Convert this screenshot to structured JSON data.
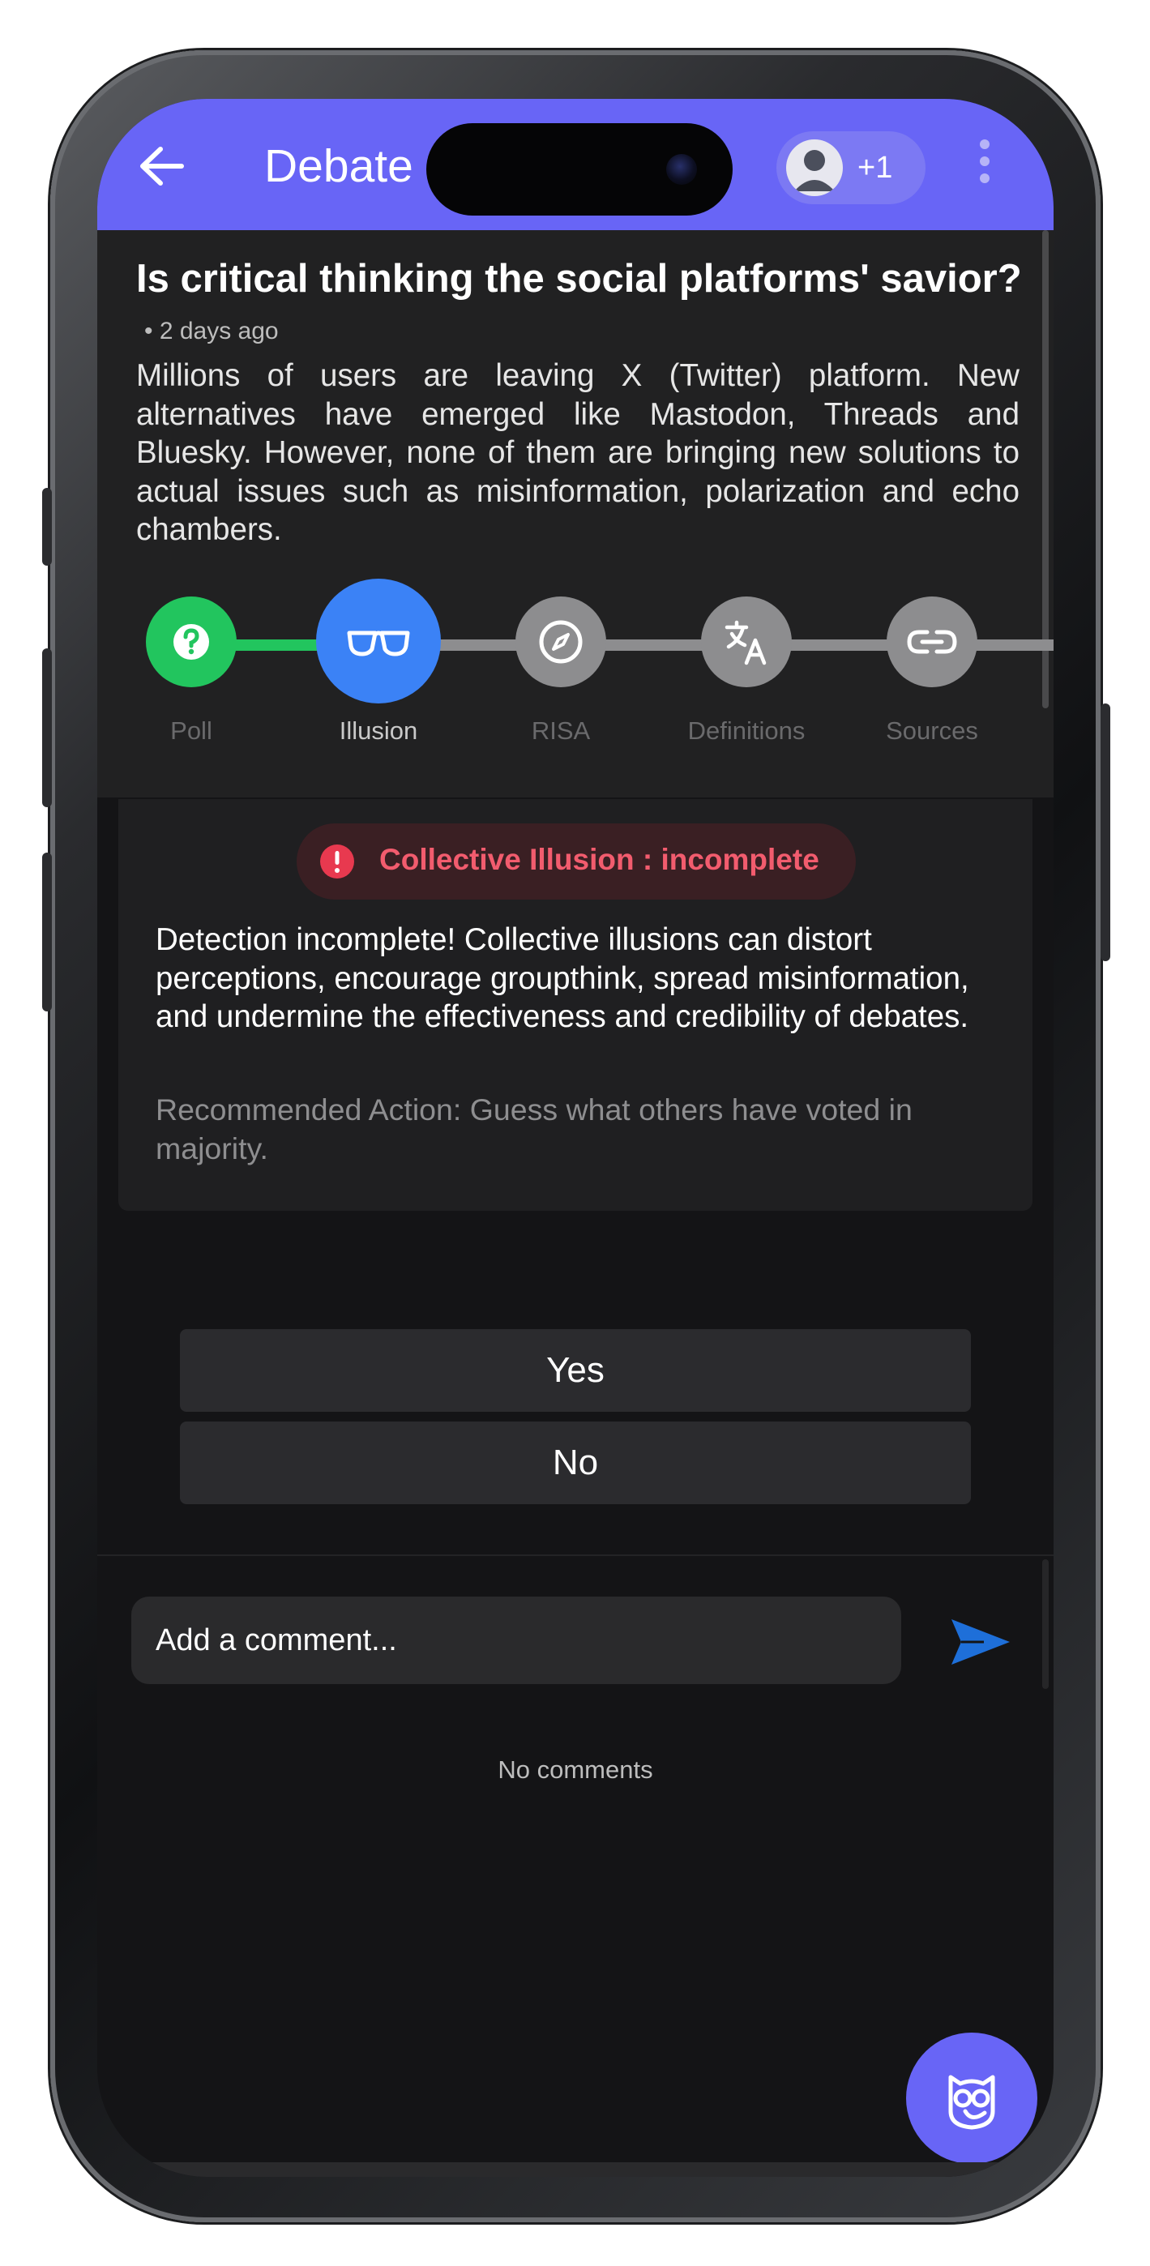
{
  "header": {
    "title": "Debate",
    "participants_extra": "+1"
  },
  "topic": {
    "title": "Is critical thinking the social platforms' savior?",
    "meta": "• 2 days ago",
    "description": "Millions of users are leaving X (Twitter) platform. New alternatives have emerged like Mastodon, Threads and Bluesky. However, none of them are bringing new solutions to actual issues such as misinformation, polarization and echo chambers."
  },
  "stepper": {
    "steps": [
      {
        "label": "Poll",
        "icon": "question-icon",
        "state": "done",
        "color": "#22c55e"
      },
      {
        "label": "Illusion",
        "icon": "glasses-icon",
        "state": "active",
        "color": "#3b82f6"
      },
      {
        "label": "RISA",
        "icon": "compass-icon",
        "state": "inactive",
        "color": "#8d8d8f"
      },
      {
        "label": "Definitions",
        "icon": "translate-icon",
        "state": "inactive",
        "color": "#8d8d8f"
      },
      {
        "label": "Sources",
        "icon": "link-icon",
        "state": "inactive",
        "color": "#8d8d8f"
      }
    ]
  },
  "illusion": {
    "status": "Collective Illusion : incomplete",
    "body": "Detection incomplete! Collective illusions can distort perceptions, encourage groupthink, spread misinformation, and undermine the effectiveness and credibility of debates.",
    "action": "Recommended Action: Guess what others have voted in majority."
  },
  "answers": {
    "yes": "Yes",
    "no": "No"
  },
  "comments": {
    "placeholder": "Add a comment...",
    "empty": "No comments"
  },
  "colors": {
    "accent": "#6865f6",
    "success": "#22c55e",
    "active": "#3b82f6",
    "error": "#f25c6e",
    "send": "#1e6fd9"
  }
}
